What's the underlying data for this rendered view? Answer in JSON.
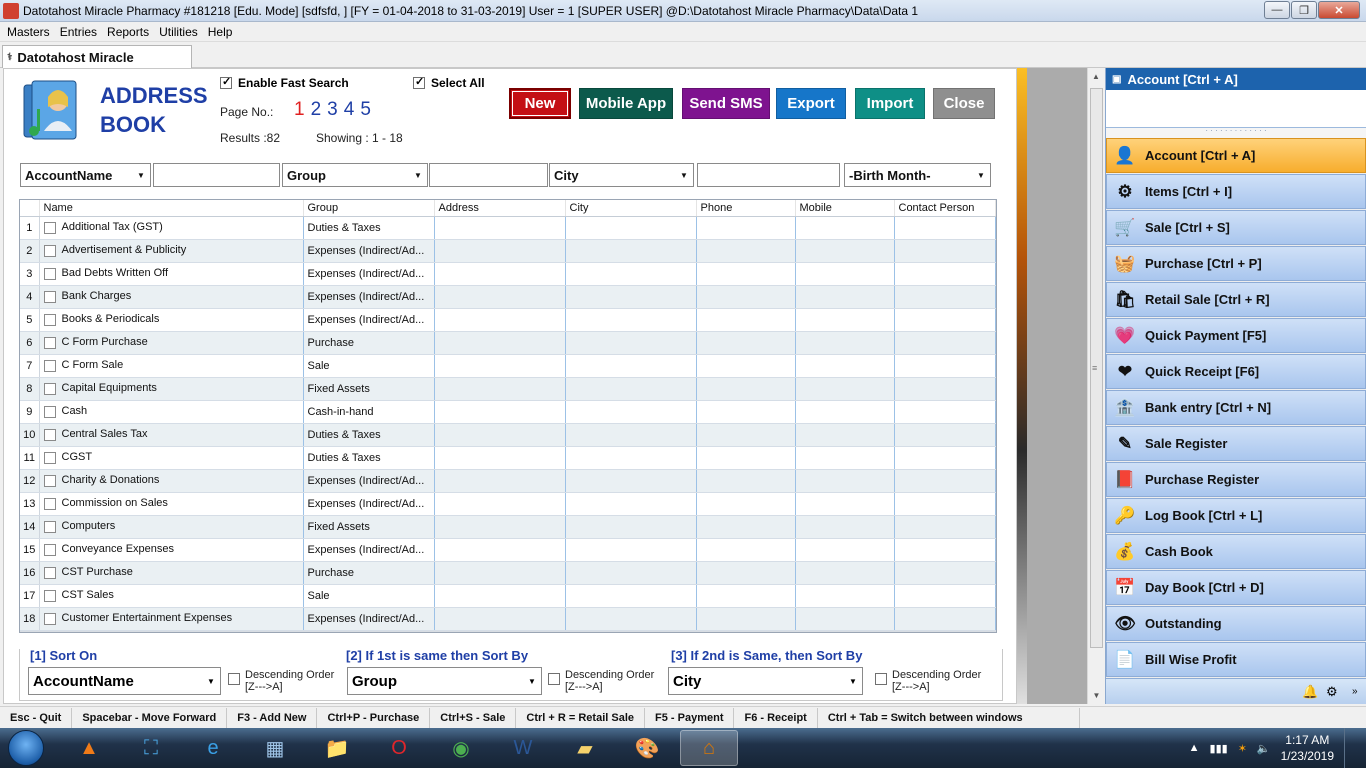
{
  "window": {
    "title": "Datotahost Miracle Pharmacy #181218  [Edu. Mode]  [sdfsfd, ]  [FY = 01-04-2018 to 31-03-2019]  User = 1 [SUPER USER]  @D:\\Datotahost Miracle Pharmacy\\Data\\Data 1",
    "minimize": "—",
    "maximize": "❐",
    "close": "✕"
  },
  "menu": [
    "Masters",
    "Entries",
    "Reports",
    "Utilities",
    "Help"
  ],
  "mdi_tab": {
    "label": "Datotahost Miracle"
  },
  "address_book": {
    "title_line1": "ADDRESS",
    "title_line2": "BOOK",
    "enable_fast_search": {
      "label": "Enable Fast Search",
      "checked": true
    },
    "select_all": {
      "label": "Select All",
      "checked": true
    },
    "page_label": "Page No.:",
    "pages": [
      "1",
      "2",
      "3",
      "4",
      "5"
    ],
    "current_page": "1",
    "results": "Results :82",
    "showing": "Showing :   1 - 18",
    "buttons": {
      "new": "New",
      "mobile_app": "Mobile App",
      "send_sms": "Send SMS",
      "export": "Export",
      "import": "Import",
      "close": "Close"
    },
    "filters": {
      "field1": "AccountName",
      "value1": "",
      "field2": "Group",
      "value2": "",
      "field3": "City",
      "value3": "",
      "birth_month": "-Birth Month-"
    },
    "columns": [
      "",
      "Name",
      "Group",
      "Address",
      "City",
      "Phone",
      "Mobile",
      "Contact Person"
    ],
    "rows": [
      {
        "n": "1",
        "name": "Additional Tax (GST)",
        "group": "Duties & Taxes"
      },
      {
        "n": "2",
        "name": "Advertisement & Publicity",
        "group": "Expenses (Indirect/Ad..."
      },
      {
        "n": "3",
        "name": "Bad Debts Written Off",
        "group": "Expenses (Indirect/Ad..."
      },
      {
        "n": "4",
        "name": "Bank Charges",
        "group": "Expenses (Indirect/Ad..."
      },
      {
        "n": "5",
        "name": "Books & Periodicals",
        "group": "Expenses (Indirect/Ad..."
      },
      {
        "n": "6",
        "name": "C Form Purchase",
        "group": "Purchase"
      },
      {
        "n": "7",
        "name": "C Form Sale",
        "group": "Sale"
      },
      {
        "n": "8",
        "name": "Capital Equipments",
        "group": "Fixed Assets"
      },
      {
        "n": "9",
        "name": "Cash",
        "group": "Cash-in-hand"
      },
      {
        "n": "10",
        "name": "Central Sales Tax",
        "group": "Duties & Taxes"
      },
      {
        "n": "11",
        "name": "CGST",
        "group": "Duties & Taxes"
      },
      {
        "n": "12",
        "name": "Charity & Donations",
        "group": "Expenses (Indirect/Ad..."
      },
      {
        "n": "13",
        "name": "Commission on Sales",
        "group": "Expenses (Indirect/Ad..."
      },
      {
        "n": "14",
        "name": "Computers",
        "group": "Fixed Assets"
      },
      {
        "n": "15",
        "name": "Conveyance Expenses",
        "group": "Expenses (Indirect/Ad..."
      },
      {
        "n": "16",
        "name": "CST Purchase",
        "group": "Purchase"
      },
      {
        "n": "17",
        "name": "CST Sales",
        "group": "Sale"
      },
      {
        "n": "18",
        "name": "Customer Entertainment Expenses",
        "group": "Expenses (Indirect/Ad..."
      }
    ],
    "sort": {
      "s1_label": "[1] Sort On",
      "s1_value": "AccountName",
      "s2_label": "[2]  If 1st is same then Sort By",
      "s2_value": "Group",
      "s3_label": "[3]  If 2nd is Same, then Sort By",
      "s3_value": "City",
      "desc_line1": "Descending Order",
      "desc_line2": "[Z--->A]"
    }
  },
  "right_panel": {
    "header": "Account [Ctrl + A]",
    "items": [
      {
        "label": "Account [Ctrl + A]",
        "icon": "👤",
        "active": true
      },
      {
        "label": "Items [Ctrl + I]",
        "icon": "⚙"
      },
      {
        "label": "Sale [Ctrl + S]",
        "icon": "🛒"
      },
      {
        "label": "Purchase [Ctrl + P]",
        "icon": "🧺"
      },
      {
        "label": "Retail Sale [Ctrl + R]",
        "icon": "🛍"
      },
      {
        "label": "Quick Payment [F5]",
        "icon": "💗"
      },
      {
        "label": "Quick Receipt [F6]",
        "icon": "❤"
      },
      {
        "label": "Bank entry [Ctrl + N]",
        "icon": "🏦"
      },
      {
        "label": "Sale Register",
        "icon": "✎"
      },
      {
        "label": "Purchase Register",
        "icon": "📕"
      },
      {
        "label": "Log Book [Ctrl + L]",
        "icon": "🔑"
      },
      {
        "label": "Cash Book",
        "icon": "💰"
      },
      {
        "label": "Day Book [Ctrl + D]",
        "icon": "📅"
      },
      {
        "label": "Outstanding",
        "icon": "👁"
      },
      {
        "label": "Bill Wise Profit",
        "icon": "📄"
      }
    ]
  },
  "shortcuts": [
    "Esc - Quit",
    "Spacebar - Move Forward",
    "F3 - Add New",
    "Ctrl+P - Purchase",
    "Ctrl+S - Sale",
    "Ctrl + R = Retail Sale",
    "F5 - Payment",
    "F6 - Receipt",
    "Ctrl + Tab = Switch between windows"
  ],
  "taskbar": {
    "apps": [
      {
        "name": "vlc",
        "glyph": "▲"
      },
      {
        "name": "screen-capture",
        "glyph": "⛶"
      },
      {
        "name": "internet-explorer",
        "glyph": "e"
      },
      {
        "name": "control-panel",
        "glyph": "▦"
      },
      {
        "name": "file-explorer",
        "glyph": "📁"
      },
      {
        "name": "opera",
        "glyph": "O"
      },
      {
        "name": "chrome",
        "glyph": "◉"
      },
      {
        "name": "word",
        "glyph": "W"
      },
      {
        "name": "sticky-notes",
        "glyph": "▰"
      },
      {
        "name": "paint",
        "glyph": "🎨"
      },
      {
        "name": "pharmacy-app",
        "glyph": "⌂",
        "active": true
      }
    ],
    "time": "1:17 AM",
    "date": "1/23/2019"
  }
}
